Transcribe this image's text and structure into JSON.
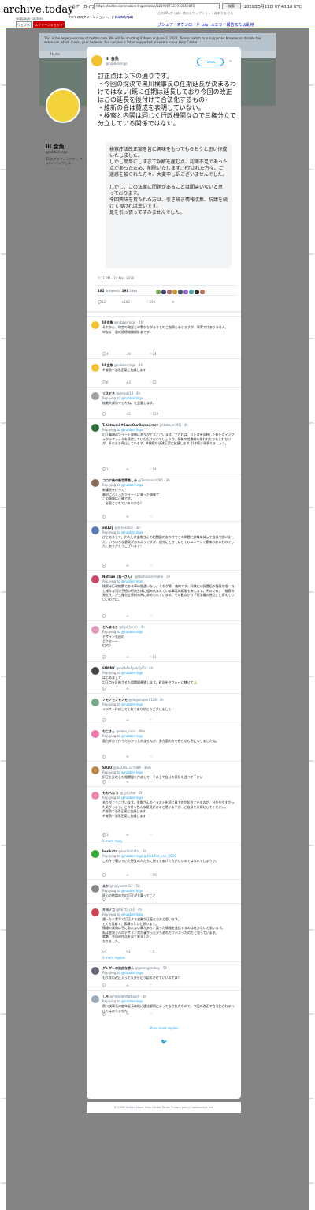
{
  "archive": {
    "brand": "archive.today",
    "subtitle": "webpage capture",
    "saved_from_label": "からアーカイブ",
    "url": "https://twitter.com/rubberringo/status/1259967327972659875",
    "search_btn": "検索",
    "date": "2020年5月11日 07:40:18 UTC",
    "no_other": "このURLからは、他のスナップショットはありません",
    "all_snapshots": "すべてのスクリーンショット。ドメインからは",
    "domain_link": "twitter.com",
    "tab_webpage": "ウェブページ",
    "tab_screenshot": "スクリーンショット",
    "nav_share": "シェア",
    "nav_download": "ダウンロード .zip",
    "nav_report": "エラー報告または乱用",
    "ruler_left": [
      "100%",
      "200%",
      "300%",
      "400%",
      "500%",
      "600%",
      "700%",
      "800%",
      "900%",
      "1000%",
      "1100%",
      "1200%",
      "1300%",
      "1400%"
    ],
    "ruler_right": [
      "100%",
      "200%",
      "300%",
      "400%",
      "500%",
      "600%",
      "700%",
      "800%",
      "900%",
      "1000%",
      "1100%",
      "1200%",
      "1300%",
      "1400%"
    ]
  },
  "legacy_banner": "This is the legacy version of twitter.com. We will be shutting it down on June 1, 2020. Please switch to a supported browser or disable the extension which masks your browser. You can see a list of supported browsers in our Help Center.",
  "twitter_header": {
    "home": "Home"
  },
  "profile": {
    "name": "lil 金魚",
    "handle": "@rubberringo",
    "bio": "3Dのグラフィックや… フォローバックしま…",
    "joined": "Joined March 20…"
  },
  "main_tweet": {
    "name": "lil 金魚",
    "handle": "@rubberringo",
    "follow_label": "Follow",
    "text": "訂正点は以下の通りです。\n・今回の採決で黒川検事長の任期延長が決まるわけではない(既に任期は延長しており今回の改正はこの延長を後付けで合法化するもの)\n・維新の会は賛成を表明していない。\n・検察と内閣は同じく行政機関なので三権分立で分立している関係ではない。",
    "quote": "検察庁法改正案を皆に興味をもってもらおうと思い作成いたしました。\nしかし簡単にしすぎて誤解を産む点、認識不足であった点があったため、削除いたします。RTされた方々、ご迷惑を被られた方々、大変申し訳ございませんでした。\n\nしかし、この法案に問題があることは間違いないと思っております。\n今回興味を持たれた方は、引き続き情報収集、抗議を続けて頂ければ幸いです。\n足を引っ張ってすみませんでした。",
    "time": "7:11 PM - 10 May 2020",
    "retweets_count": "182",
    "retweets_label": "Retweets",
    "likes_count": "193",
    "likes_label": "Likes",
    "reply_count": "52",
    "rt_count": "182",
    "like_count": "193"
  },
  "replies": [
    {
      "name": "lil 金魚",
      "handle": "@rubberringo · 4h",
      "to": "",
      "text": "それから、特定の政党との繋がりがあるとのご指摘もありますが、事実ではありません。\n単なる一般の医療機械設計者です。",
      "r": "4",
      "rt": "9",
      "lk": "24",
      "more": ""
    },
    {
      "name": "lil 金魚",
      "handle": "@rubberringo · 4h",
      "to": "",
      "text": "#検察庁法改正案に抗議します",
      "r": "6",
      "rt": "3",
      "lk": "15",
      "more": ""
    },
    {
      "name": "リスドネ",
      "handle": "@meyer18 · 4h",
      "to": "@rubberringo",
      "text": "拡散大成功でしたね。社会悪します。",
      "r": "",
      "rt": "5",
      "lk": "119",
      "more": ""
    },
    {
      "name": "T.Katsumi #SaveOurDemocracy",
      "handle": "@tkatsumi96j · 4h",
      "to": "@rubberringo",
      "text": "訂正事項のツイート詳細にありがとうございます。できれば、訂正点を反映した新たなインフォグラフィックを発信していただけないでしょうか。情報の信憑性を失われたかもしれないが、そのまま停止しています。#検察庁法改正案に抗議します 引き続き頑張りましょう。",
      "r": "1",
      "rt": "",
      "lk": "14",
      "more": ""
    },
    {
      "name": "コロナ後の新世界楽しみ",
      "handle": "@Tanizono1005 · 3h",
      "to": "@rubberringo",
      "text": "新議院を作って\n最初にバズったツイートに載った情報で\nこの情報は正確です。\n...必要とされているのかな？",
      "r": "",
      "rt": "",
      "lk": "",
      "more": ""
    },
    {
      "name": "ari12y",
      "handle": "@brsexdice · 3h",
      "to": "@rubberringo",
      "text": "はじめまして。わたしは金魚さんの相関図のおかげでこの問題に興味を持って自分で調べました。いろいろな意見があるようですが、自分にとってはとてもユニークで意味のあるものでした。ありがとうございます！",
      "r": "",
      "rt": "",
      "lk": "",
      "more": ""
    },
    {
      "name": "Nathan（ね~さん）",
      "handle": "@Nathanknrmohe · 3h",
      "to": "@rubberringo",
      "text": "検察は行政機関である事は間違いなし。それが第一義的です。同様に公訴提起の権限を唯一有し様々な司法手続の行為主体に組み込まれている事実的権限も有します。そのため、「検察の独立性」が三権分立原則の為に求められています。その観点から「司法権の独立」と捉えてもいいのでは。",
      "r": "",
      "rt": "",
      "lk": "",
      "more": ""
    },
    {
      "name": "とんまるき",
      "handle": "@kyo_tonm · 4h",
      "to": "@rubberringo",
      "text": "デザイン七連の\nどうせ〜〜\n(ﾟ∀ﾟ)",
      "r": "",
      "rt": "",
      "lk": "11",
      "more": ""
    },
    {
      "name": "SUNNY",
      "handle": "@mAhAnAyAk5yVz · 4h",
      "to": "@rubberringo",
      "text": "はじめまして\n訂正点を反映させた相関図希望します。政治をセクシーに魅せて🙏",
      "r": "",
      "rt": "",
      "lk": "",
      "more": ""
    },
    {
      "name": "ノモノモノモノモ",
      "handle": "@degusuper0128 · 3h",
      "to": "@rubberringo",
      "text": "イラスト作成してくれてありがとうございました！",
      "r": "",
      "rt": "",
      "lk": "",
      "more": ""
    },
    {
      "name": "ねこさん",
      "handle": "@neko_cara · 49m",
      "to": "@rubberringo",
      "text": "面白半分で作ったのかもしれませんが、多方面の方を巻き込む形になりましたね。",
      "r": "",
      "rt": "",
      "lk": "",
      "more": ""
    },
    {
      "name": "SUZU",
      "handle": "@SUZUS1127089 · 36m",
      "to": "@rubberringo",
      "text": "訂正を反映した相関図を作成して、その上で自分の意見を述べて下さい",
      "r": "",
      "rt": "",
      "lk": "",
      "more": ""
    },
    {
      "name": "ももぺん🐧",
      "handle": "@_pi_char · 2h",
      "to": "@rubberringo",
      "text": "ありがとうございます。金魚さんのイラストを読む事で何が起きているのか、分かりやすかった気がします。この件も色んな意見があると思いますが、ご自身を大切にしてください。\n#検察庁法改正案に抗議します\n#検察庁法改正案に抗議します",
      "r": "1",
      "rt": "",
      "lk": "",
      "more": "1 more reply"
    },
    {
      "name": "berikata",
      "handle": "@berihimatai · 3h",
      "to": "@rubberringo @hikkifee_san_2020",
      "text": "この件で騒いでいた野党の人たちに教えてあげた方がいいのではないでしょうか。",
      "r": "",
      "rt": "",
      "lk": "59",
      "more": ""
    },
    {
      "name": "るか",
      "handle": "@halyosemi17 · 5h",
      "to": "@rubberringo",
      "text": "肝心の結論の方の訂正が大事ってこと",
      "r": "",
      "rt": "",
      "lk": "",
      "more": ""
    },
    {
      "name": "キヨノカ",
      "handle": "@KEYO_cn1 · 4h",
      "to": "@rubberringo",
      "text": "違ったら素早く訂正する姿勢が正直な方だと思います。\nとても素敵で、素晴らしいと思います。\n情報の真偽は手に取れない事があり、誤った情報を発信するのは仕方ないと思います。\n私は金魚さんのデザイン力が凄かったからあれだけバズったのだと思っています。\n素敵、今回の作品を見て来ました。\nなりました。",
      "r": "",
      "rt": "1",
      "lk": "5",
      "more": "3 more replies"
    },
    {
      "name": "グレグレの自由な旅人",
      "handle": "@gureegreeboy · 5h",
      "to": "@rubberringo",
      "text": "もう次の改正入ってる多分どう認めさせていいのでは？",
      "r": "",
      "rt": "",
      "lk": "",
      "more": ""
    },
    {
      "name": "しろ",
      "handle": "@PiIrtidhRft8Naxl9 · 4h",
      "to": "@rubberringo",
      "text": "黒川検事長の定年延長は既に違法解釈によってなされたもので、今回の改正で合法化されるわけではありません",
      "r": "",
      "rt": "",
      "lk": "",
      "more": ""
    }
  ],
  "show_more": "Show more replies",
  "footer": "© 2020 Twitter   About   Help Center   Terms   Privacy policy   Cookies   Ads info"
}
